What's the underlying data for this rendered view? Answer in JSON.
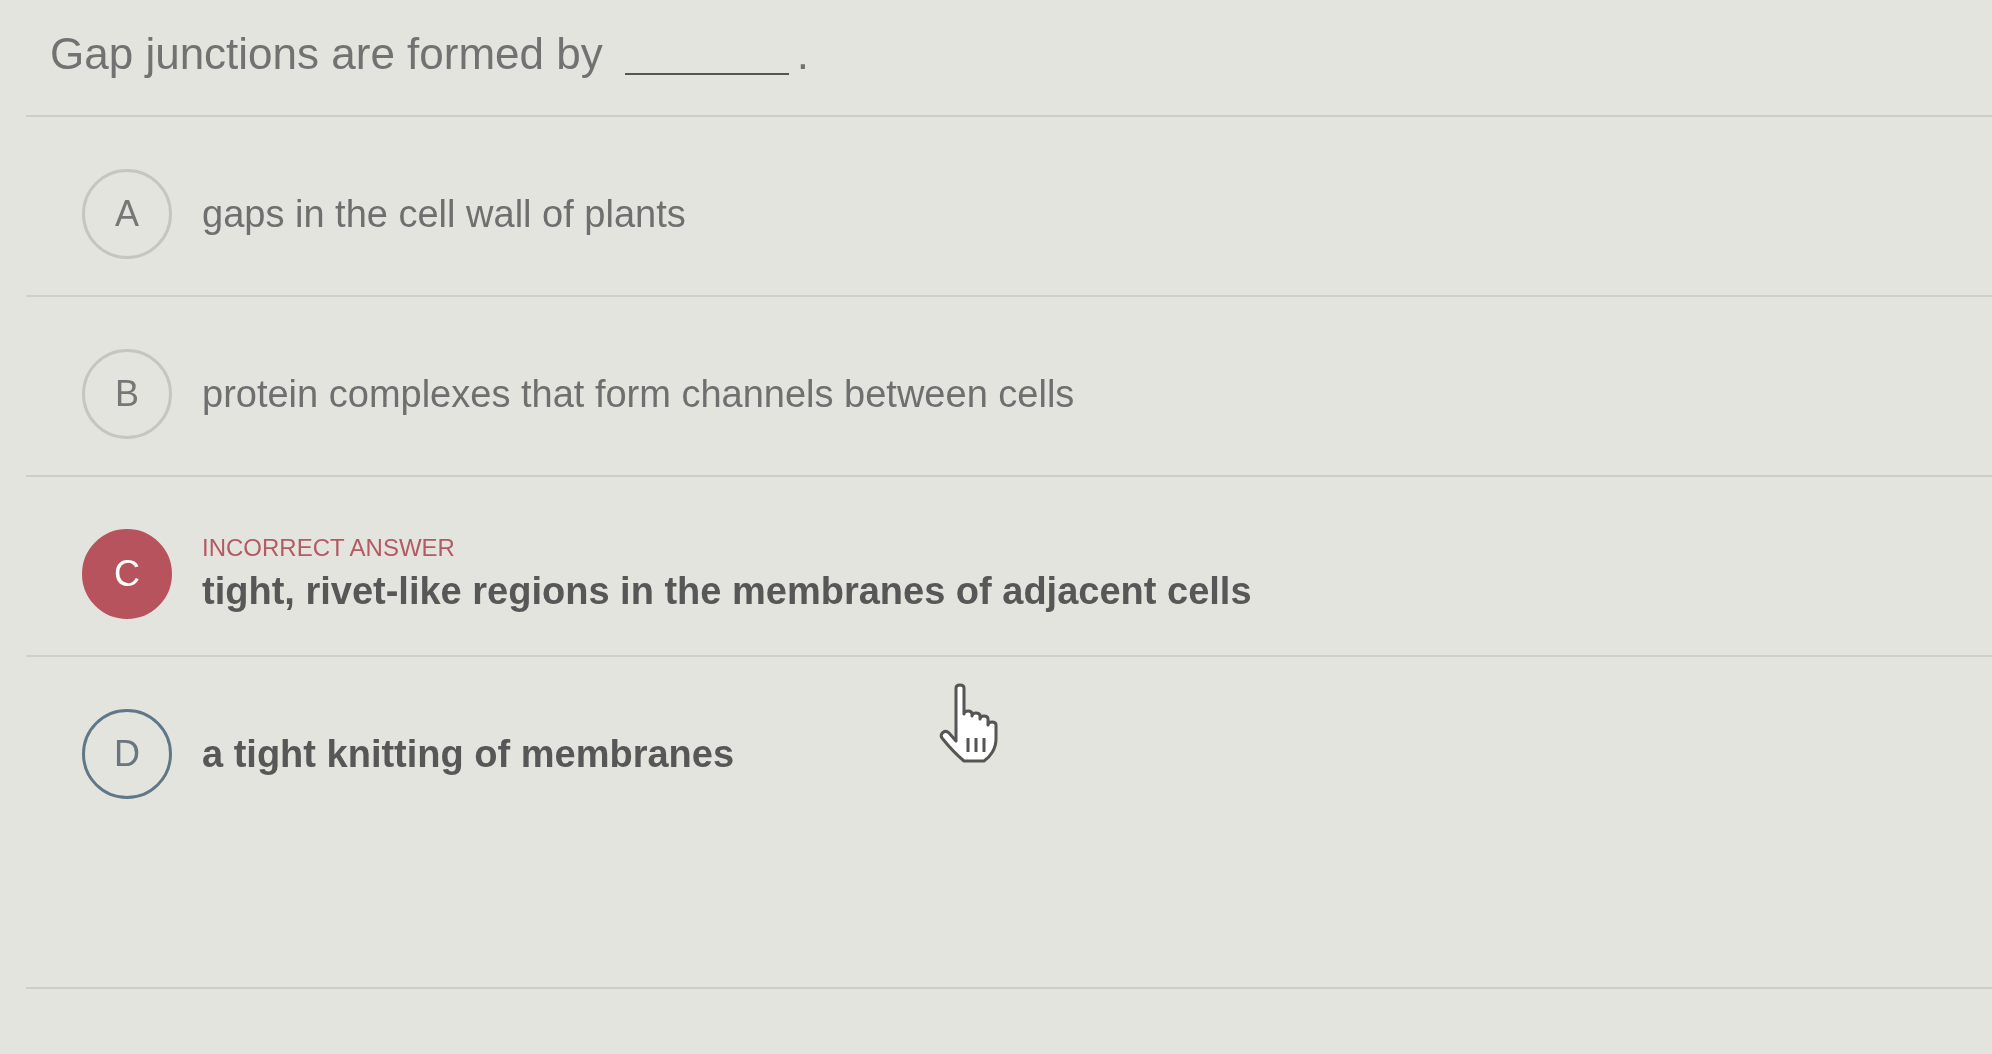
{
  "question": {
    "text": "Gap junctions are formed by",
    "end": "."
  },
  "options": [
    {
      "letter": "A",
      "text": "gaps in the cell wall of plants",
      "selected": false,
      "hovered": false
    },
    {
      "letter": "B",
      "text": "protein complexes that form channels between cells",
      "selected": false,
      "hovered": false
    },
    {
      "letter": "C",
      "feedback": "INCORRECT ANSWER",
      "text": "tight, rivet-like regions in the membranes of adjacent cells",
      "selected": true,
      "hovered": false
    },
    {
      "letter": "D",
      "text": "a tight knitting of membranes",
      "selected": false,
      "hovered": true
    }
  ]
}
